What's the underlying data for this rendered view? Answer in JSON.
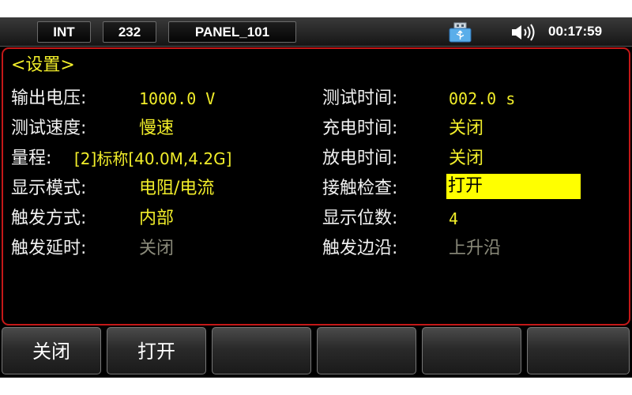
{
  "status_bar": {
    "tabs": [
      "INT",
      "232",
      "PANEL_101"
    ],
    "clock": "00:17:59",
    "icons": [
      "usb-icon",
      "speaker-volume-icon"
    ]
  },
  "panel": {
    "title": "<设置>",
    "left": [
      {
        "label": "输出电压:",
        "value": "1000.0 V",
        "state": "active"
      },
      {
        "label": "测试速度:",
        "value": "慢速",
        "state": "active"
      },
      {
        "label": "量程:",
        "value": "[2]标称[40.0M,4.2G]",
        "state": "active"
      },
      {
        "label": "显示模式:",
        "value": "电阻/电流",
        "state": "active"
      },
      {
        "label": "触发方式:",
        "value": "内部",
        "state": "active"
      },
      {
        "label": "触发延时:",
        "value": "关闭",
        "state": "disabled"
      }
    ],
    "right": [
      {
        "label": "测试时间:",
        "value": "002.0 s",
        "state": "active"
      },
      {
        "label": "充电时间:",
        "value": "关闭",
        "state": "active"
      },
      {
        "label": "放电时间:",
        "value": "关闭",
        "state": "active"
      },
      {
        "label": "接触检查:",
        "value": "打开",
        "state": "selected"
      },
      {
        "label": "显示位数:",
        "value": "4",
        "state": "active"
      },
      {
        "label": "触发边沿:",
        "value": "上升沿",
        "state": "disabled"
      }
    ]
  },
  "softkeys": [
    "关闭",
    "打开",
    "",
    "",
    "",
    ""
  ],
  "colors": {
    "value": "#f2ee2a",
    "disabled": "#8a8a7a",
    "selected_bg": "#ffff00",
    "panel_border": "#c41818"
  }
}
